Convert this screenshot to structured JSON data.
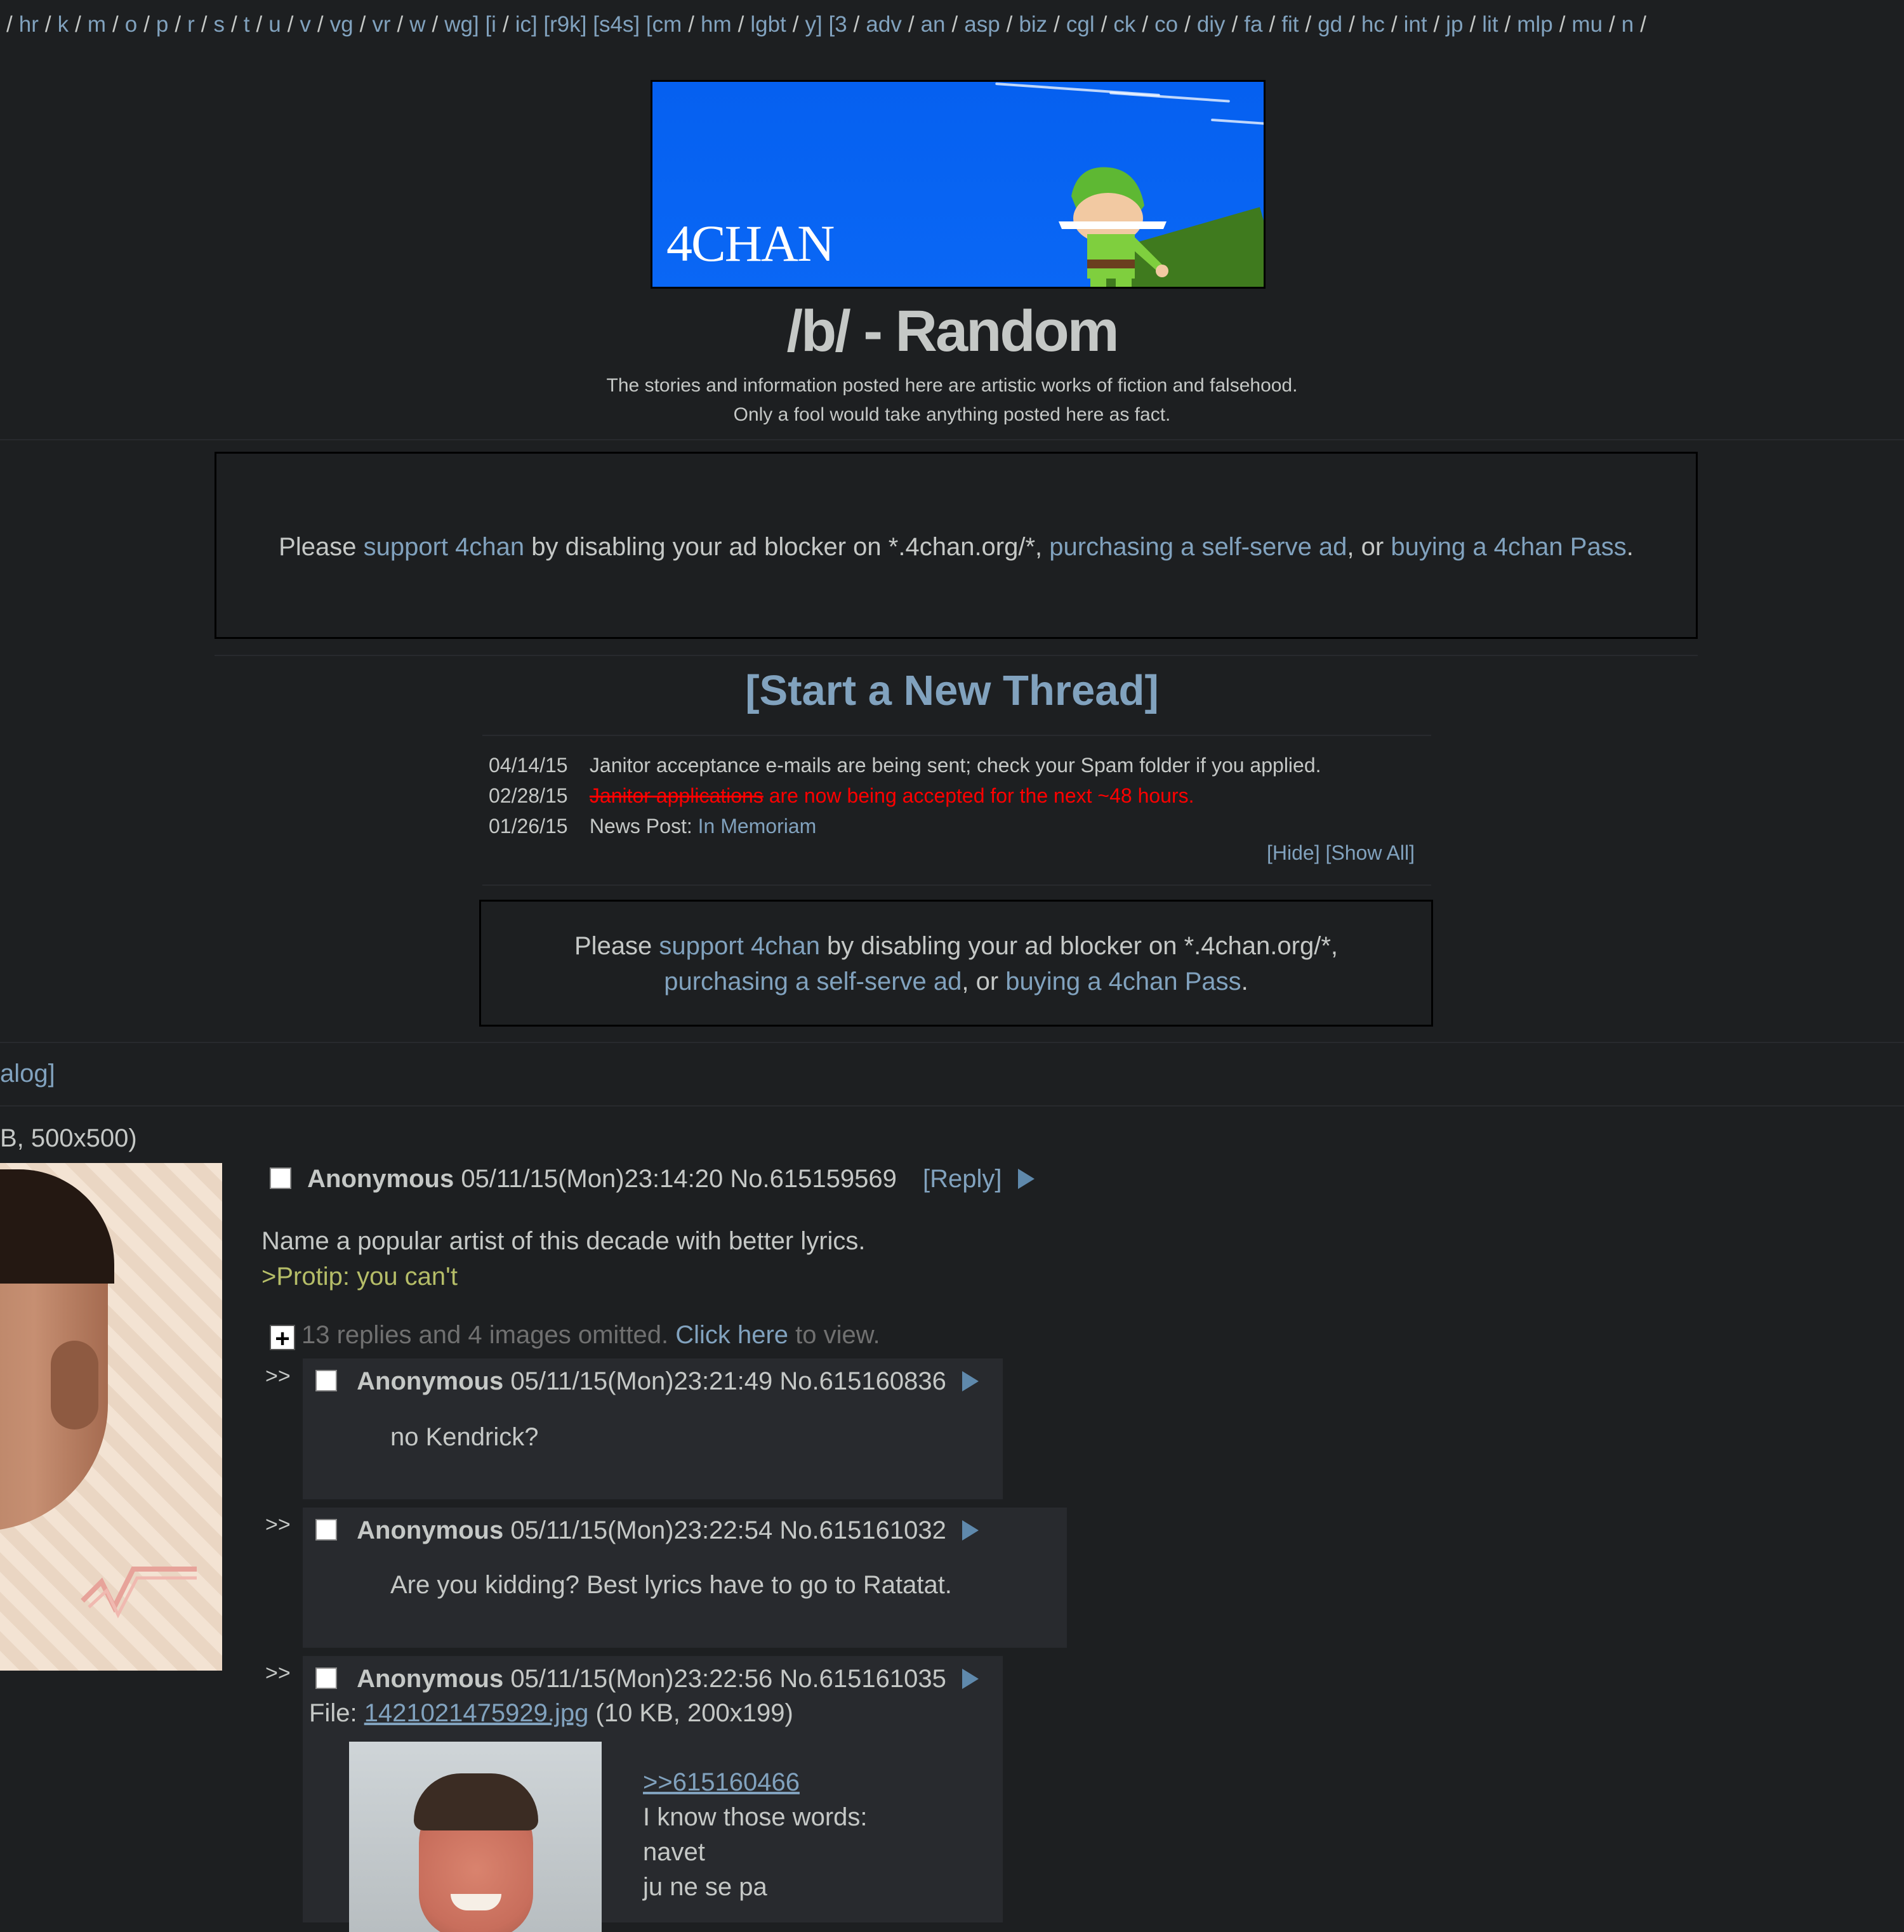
{
  "boardnav": {
    "leading_sep": "/",
    "boards": [
      "hr",
      "k",
      "m",
      "o",
      "p",
      "r",
      "s",
      "t",
      "u",
      "v",
      "vg",
      "vr",
      "w",
      "wg] [i",
      "ic] [r9k] [s4s] [cm",
      "hm",
      "lgbt",
      "y] [3",
      "adv",
      "an",
      "asp",
      "biz",
      "cgl",
      "ck",
      "co",
      "diy",
      "fa",
      "fit",
      "gd",
      "hc",
      "int",
      "jp",
      "lit",
      "mlp",
      "mu",
      "n"
    ],
    "trailing_sep": "/"
  },
  "banner": {
    "logo_text": "4CHAN"
  },
  "board": {
    "title": "/b/ - Random",
    "subtitle_line1": "The stories and information posted here are artistic works of fiction and falsehood.",
    "subtitle_line2": "Only a fool would take anything posted here as fact."
  },
  "ad1": {
    "prefix": "Please ",
    "link1": "support 4chan",
    "mid1": " by disabling your ad blocker on *.4chan.org/*, ",
    "link2": "purchasing a self-serve ad",
    "mid2": ", or ",
    "link3": "buying a 4chan Pass",
    "suffix": "."
  },
  "start_thread": "[Start a New Thread]",
  "news": [
    {
      "date": "04/14/15",
      "text": "Janitor acceptance e-mails are being sent; check your Spam folder if you applied."
    },
    {
      "date": "02/28/15",
      "strike": "Janitor applications",
      "text": " are now being accepted for the next ~48 hours."
    },
    {
      "date": "01/26/15",
      "label": "News Post: ",
      "link": "In Memoriam"
    }
  ],
  "news_controls": {
    "hide": "[Hide]",
    "show_all": "[Show All]"
  },
  "ad2": {
    "prefix": "Please ",
    "link1": "support 4chan",
    "mid1": " by disabling your ad blocker on *.4chan.org/*,",
    "link2": "purchasing a self-serve ad",
    "mid2": ", or ",
    "link3": "buying a 4chan Pass",
    "suffix": "."
  },
  "catalog_link": "alog]",
  "op": {
    "fileinfo": "B, 500x500)",
    "name": "Anonymous",
    "datetime": "05/11/15(Mon)23:14:20",
    "post_no": "No.615159569",
    "reply_link": "[Reply]",
    "body_line1": "Name a popular artist of this decade with better lyrics.",
    "body_greentext": ">Protip: you can't"
  },
  "omitted": {
    "text": "13 replies and 4 images omitted. ",
    "link": "Click here",
    "suffix": " to view."
  },
  "replies": [
    {
      "arrow": ">>",
      "name": "Anonymous",
      "datetime": "05/11/15(Mon)23:21:49",
      "post_no": "No.615160836",
      "message": "no Kendrick?"
    },
    {
      "arrow": ">>",
      "name": "Anonymous",
      "datetime": "05/11/15(Mon)23:22:54",
      "post_no": "No.615161032",
      "message": "Are you kidding? Best lyrics have to go to Ratatat."
    },
    {
      "arrow": ">>",
      "name": "Anonymous",
      "datetime": "05/11/15(Mon)23:22:56",
      "post_no": "No.615161035",
      "file_label": "File: ",
      "file_name": "1421021475929.jpg",
      "file_meta": " (10 KB, 200x199)",
      "quote_link": ">>615160466",
      "lines": [
        "I know those words:",
        "navet",
        "ju ne se pa"
      ]
    }
  ],
  "colors": {
    "background": "#1d1f21",
    "text": "#c5c8c6",
    "link": "#81a2be",
    "greentext": "#b5bd68",
    "alert": "#ff0000",
    "post_bg": "#282a2e"
  }
}
